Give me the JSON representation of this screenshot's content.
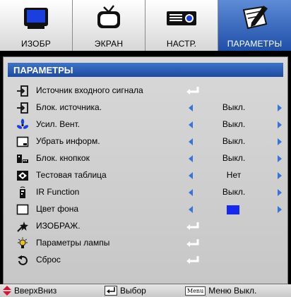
{
  "tabs": [
    {
      "label": "ИЗОБР",
      "icon": "monitor-icon"
    },
    {
      "label": "ЭКРАН",
      "icon": "tv-icon"
    },
    {
      "label": "НАСТР.",
      "icon": "projector-icon"
    },
    {
      "label": "ПАРАМЕТРЫ",
      "icon": "pencil-icon",
      "active": true
    }
  ],
  "panel": {
    "title": "ПАРАМЕТРЫ",
    "items": [
      {
        "label": "Источник входного сигнала",
        "icon": "input-source-icon",
        "control": "enter"
      },
      {
        "label": "Блок. источника.",
        "icon": "source-lock-icon",
        "control": "select",
        "value": "Выкл."
      },
      {
        "label": "Усил. Вент.",
        "icon": "fan-icon",
        "control": "select",
        "value": "Выкл."
      },
      {
        "label": "Убрать информ.",
        "icon": "hide-info-icon",
        "control": "select",
        "value": "Выкл."
      },
      {
        "label": "Блок. кнопкок",
        "icon": "keypad-lock-icon",
        "control": "select",
        "value": "Выкл."
      },
      {
        "label": "Тестовая таблица",
        "icon": "test-pattern-icon",
        "control": "select",
        "value": "Нет"
      },
      {
        "label": "IR Function",
        "icon": "remote-icon",
        "control": "select",
        "value": "Выкл."
      },
      {
        "label": "Цвет фона",
        "icon": "background-color-icon",
        "control": "color",
        "color": "#1428f0"
      },
      {
        "label": "ИЗОБРАЖ.",
        "icon": "star-icon",
        "control": "enter"
      },
      {
        "label": "Параметры лампы",
        "icon": "lamp-icon",
        "control": "enter"
      },
      {
        "label": "Сброс",
        "icon": "reset-icon",
        "control": "enter"
      }
    ]
  },
  "footer": {
    "nav_label": "ВверхВниз",
    "select_label": "Выбор",
    "menu_key": "Menu",
    "exit_label": "Меню Выкл."
  },
  "colors": {
    "accent": "#1c4aa0",
    "arrow": "#3b74d8",
    "nav_arrow": "#e0102a"
  }
}
